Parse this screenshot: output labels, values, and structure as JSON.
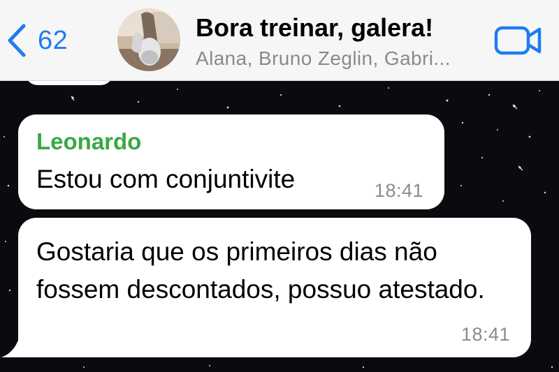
{
  "header": {
    "back_count": "62",
    "title": "Bora treinar, galera!",
    "subtitle": "Alana, Bruno Zeglin, Gabri..."
  },
  "colors": {
    "accent": "#1e7cf2",
    "sender_name": "#3aa844",
    "chat_background": "#0b0b0f",
    "bubble": "#ffffff",
    "timestamp": "#8c8c8c"
  },
  "icons": {
    "back": "chevron-left-icon",
    "video_call": "video-camera-icon"
  },
  "messages": [
    {
      "sender": "Leonardo",
      "text": "Estou com conjuntivite",
      "time": "18:41"
    },
    {
      "sender": "",
      "text": "Gostaria que os primeiros dias não fossem descontados, possuo atestado.",
      "time": "18:41"
    }
  ]
}
